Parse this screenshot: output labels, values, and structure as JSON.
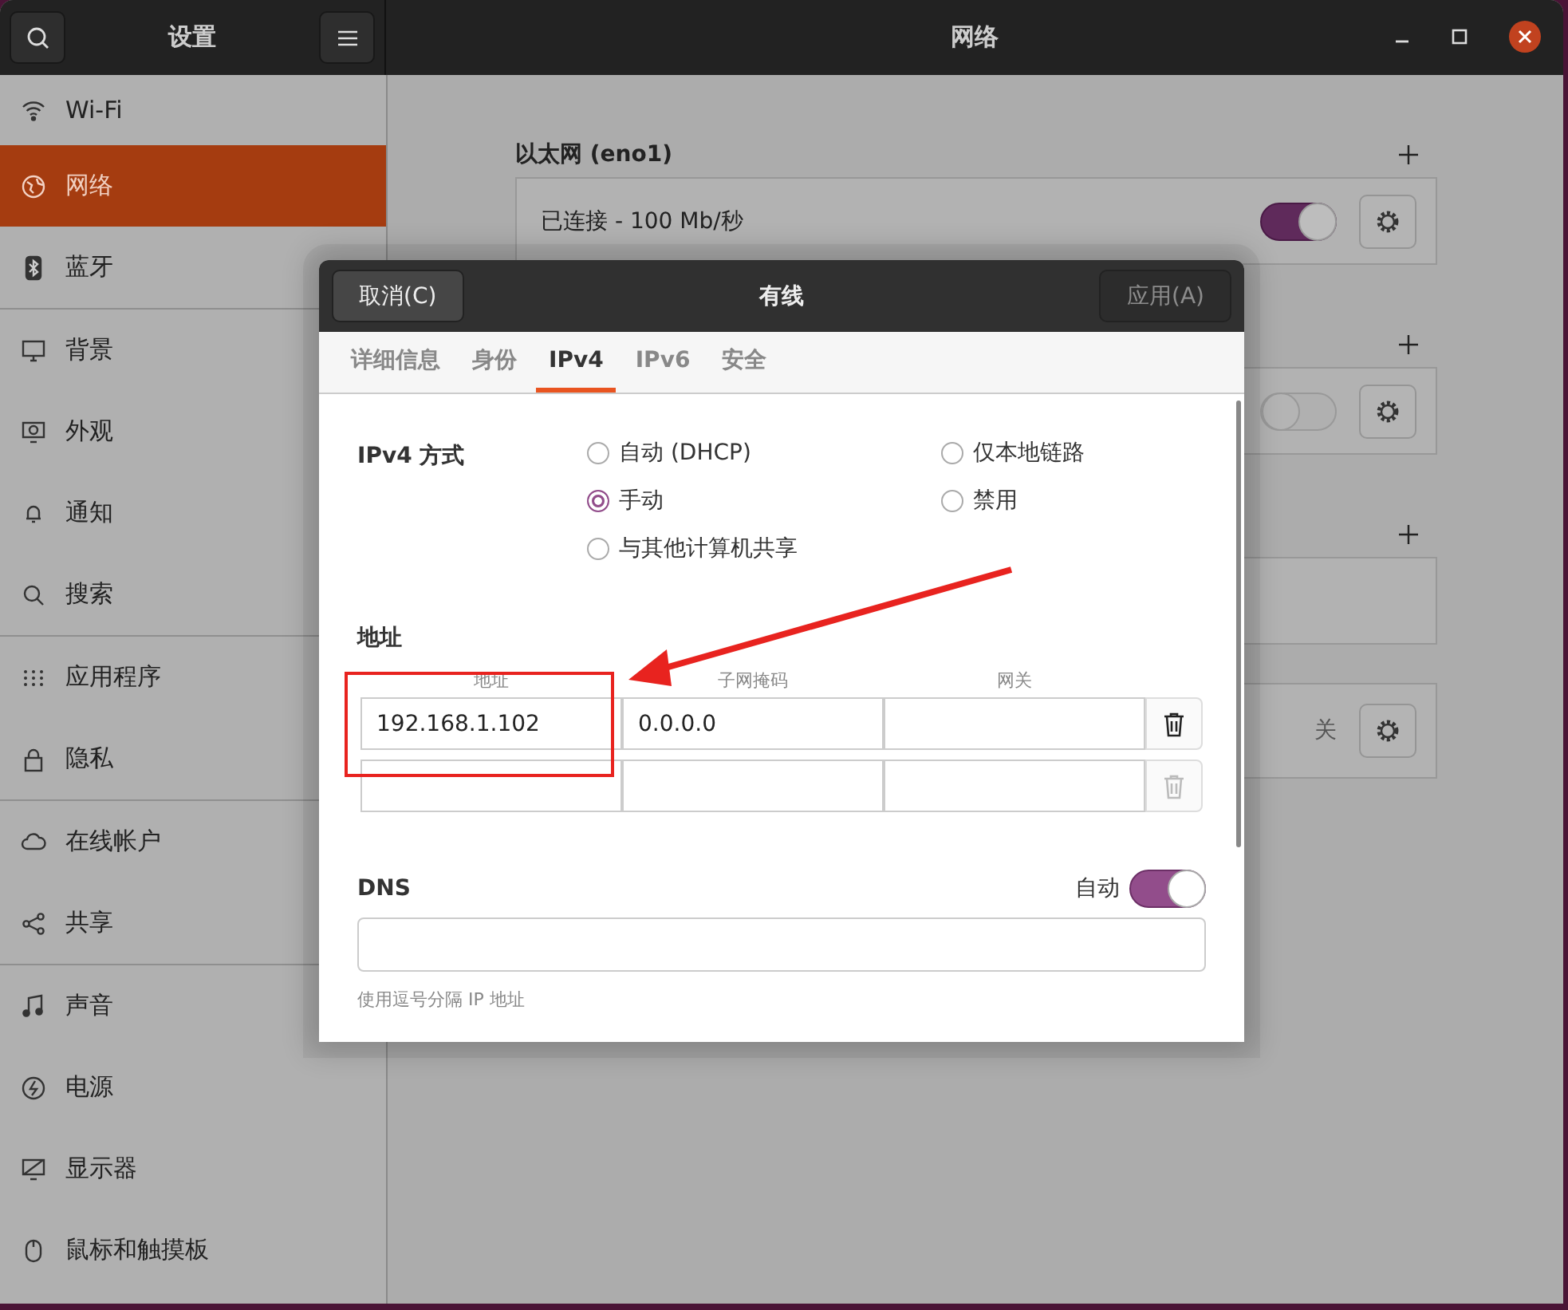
{
  "header": {
    "sidebar_title": "设置",
    "title": "网络"
  },
  "sidebar": {
    "groups": [
      [
        {
          "label": "Wi-Fi",
          "selected": false
        },
        {
          "label": "网络",
          "selected": true
        },
        {
          "label": "蓝牙",
          "selected": false
        }
      ],
      [
        {
          "label": "背景",
          "selected": false
        },
        {
          "label": "外观",
          "selected": false
        },
        {
          "label": "通知",
          "selected": false
        },
        {
          "label": "搜索",
          "selected": false
        }
      ],
      [
        {
          "label": "应用程序",
          "selected": false
        },
        {
          "label": "隐私",
          "selected": false
        }
      ],
      [
        {
          "label": "在线帐户",
          "selected": false
        },
        {
          "label": "共享",
          "selected": false
        }
      ],
      [
        {
          "label": "声音",
          "selected": false
        },
        {
          "label": "电源",
          "selected": false
        },
        {
          "label": "显示器",
          "selected": false
        },
        {
          "label": "鼠标和触摸板",
          "selected": false
        }
      ]
    ]
  },
  "sections": [
    {
      "title": "以太网 (eno1)",
      "card": {
        "kind": "toggle",
        "status": "已连接 - 100 Mb/秒",
        "on": true
      }
    },
    {
      "card": {
        "kind": "toggle",
        "on": false
      }
    },
    {
      "card": {
        "kind": "empty"
      }
    }
  ],
  "proxy": {
    "status": "关"
  },
  "dialog": {
    "title": "有线",
    "cancel": "取消(C)",
    "apply": {
      "label": "应用(A)",
      "disabled": true
    },
    "tabs": [
      {
        "label": "详细信息",
        "selected": false
      },
      {
        "label": "身份",
        "selected": false
      },
      {
        "label": "IPv4",
        "selected": true
      },
      {
        "label": "IPv6",
        "selected": false
      },
      {
        "label": "安全",
        "selected": false
      }
    ],
    "method": {
      "label": "IPv4 方式",
      "options": [
        {
          "label": "自动 (DHCP)",
          "selected": false
        },
        {
          "label": "仅本地链路",
          "selected": false
        },
        {
          "label": "手动",
          "selected": true
        },
        {
          "label": "禁用",
          "selected": false
        },
        {
          "label": "与其他计算机共享",
          "selected": false
        }
      ]
    },
    "addresses": {
      "title": "地址",
      "columns": [
        "地址",
        "子网掩码",
        "网关"
      ],
      "rows": [
        {
          "address": "192.168.1.102",
          "netmask": "0.0.0.0",
          "delete_enabled": true
        },
        {
          "delete_enabled": false
        }
      ]
    },
    "dns": {
      "title": "DNS",
      "auto_label": "自动",
      "auto": true,
      "hint": "使用逗号分隔 IP 地址"
    }
  }
}
